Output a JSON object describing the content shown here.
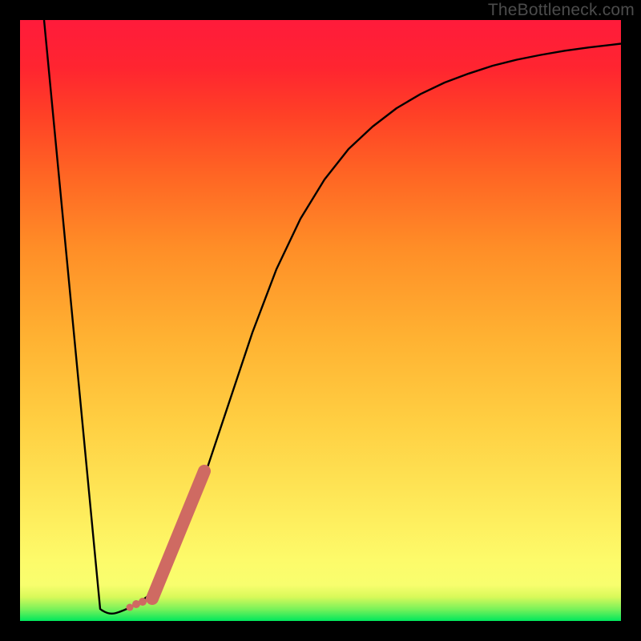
{
  "attribution": "TheBottleneck.com",
  "chart_data": {
    "type": "line",
    "title": "",
    "xlabel": "",
    "ylabel": "",
    "xlim": [
      0,
      100
    ],
    "ylim": [
      0,
      100
    ],
    "series": [
      {
        "name": "curve-left",
        "x": [
          4.0,
          13.3
        ],
        "y": [
          100.0,
          2.0
        ]
      },
      {
        "name": "curve-valley",
        "x": [
          13.3,
          14.7,
          16.0,
          18.7,
          21.3,
          22.7
        ],
        "y": [
          2.0,
          1.0,
          1.3,
          2.5,
          4.0,
          5.3
        ]
      },
      {
        "name": "curve-right",
        "x": [
          22.7,
          26.7,
          30.7,
          34.7,
          38.7,
          42.7,
          46.7,
          50.7,
          54.7,
          58.7,
          62.7,
          66.7,
          70.7,
          74.7,
          78.7,
          82.7,
          86.7,
          90.7,
          94.7,
          100.0
        ],
        "y": [
          5.3,
          13.0,
          24.0,
          36.0,
          48.0,
          58.5,
          67.0,
          73.5,
          78.5,
          82.3,
          85.3,
          87.7,
          89.6,
          91.1,
          92.4,
          93.4,
          94.2,
          94.9,
          95.5,
          96.1
        ]
      },
      {
        "name": "highlight-band",
        "x": [
          22.0,
          30.7
        ],
        "y": [
          3.5,
          25.0
        ]
      },
      {
        "name": "highlight-dots",
        "x": [
          19.3,
          18.3,
          20.0
        ],
        "y": [
          2.9,
          2.3,
          3.1
        ]
      }
    ],
    "background_gradient": {
      "direction": "vertical",
      "stops": [
        {
          "pos": 0.0,
          "color": "#ff1b3b"
        },
        {
          "pos": 0.08,
          "color": "#ff2530"
        },
        {
          "pos": 0.16,
          "color": "#ff4126"
        },
        {
          "pos": 0.26,
          "color": "#ff6624"
        },
        {
          "pos": 0.38,
          "color": "#ff8e27"
        },
        {
          "pos": 0.53,
          "color": "#ffb232"
        },
        {
          "pos": 0.67,
          "color": "#ffcf42"
        },
        {
          "pos": 0.8,
          "color": "#fee858"
        },
        {
          "pos": 0.9,
          "color": "#fdfb6a"
        },
        {
          "pos": 0.94,
          "color": "#f8fe6e"
        },
        {
          "pos": 0.96,
          "color": "#d8f95a"
        },
        {
          "pos": 0.98,
          "color": "#7bf25a"
        },
        {
          "pos": 1.0,
          "color": "#00e75c"
        }
      ]
    },
    "colors": {
      "curve": "#000000",
      "highlight": "#cf6a62",
      "frame": "#000000",
      "watermark": "#4c4c4c"
    }
  }
}
